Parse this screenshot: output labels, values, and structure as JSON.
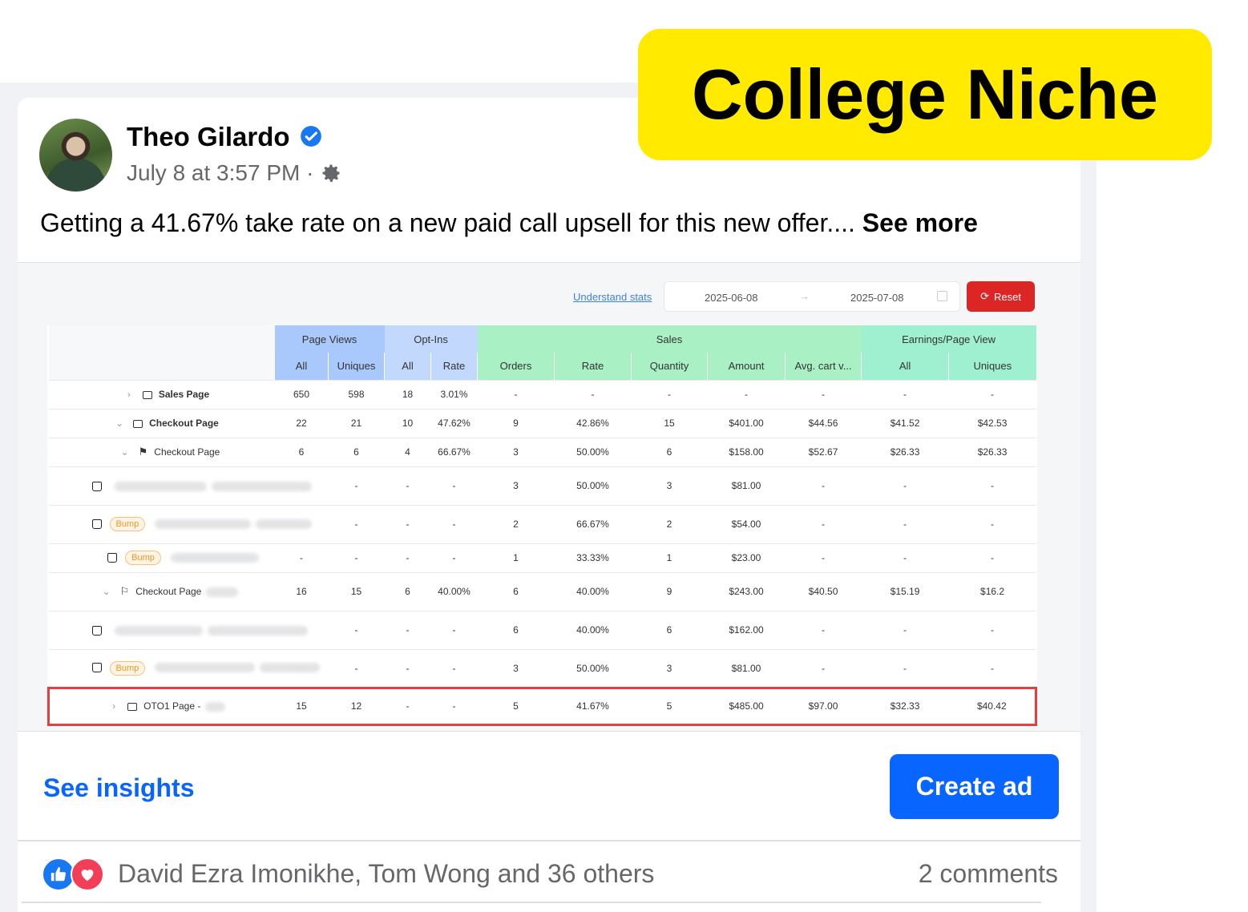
{
  "banner": {
    "text": "College Niche"
  },
  "post": {
    "author": "Theo Gilardo",
    "timestamp": "July 8 at 3:57 PM ·",
    "text": "Getting a 41.67% take rate on a new paid call upsell for this new offer....",
    "see_more": "See more"
  },
  "stats": {
    "understand_link": "Understand stats",
    "date_from": "2025-06-08",
    "date_arrow": "→",
    "date_to": "2025-07-08",
    "reset_label": "Reset",
    "groups": {
      "page_views": "Page Views",
      "opt_ins": "Opt-Ins",
      "sales": "Sales",
      "earnings": "Earnings/Page View"
    },
    "columns": {
      "all": "All",
      "uniques": "Uniques",
      "rate": "Rate",
      "orders": "Orders",
      "quantity": "Quantity",
      "amount": "Amount",
      "avg_cart": "Avg. cart v..."
    },
    "bump_label": "Bump",
    "rows": [
      {
        "name": "Sales Page",
        "v": [
          "650",
          "598",
          "18",
          "3.01%",
          "-",
          "-",
          "-",
          "-",
          "-",
          "-",
          "-"
        ]
      },
      {
        "name": "Checkout Page",
        "v": [
          "22",
          "21",
          "10",
          "47.62%",
          "9",
          "42.86%",
          "15",
          "$401.00",
          "$44.56",
          "$41.52",
          "$42.53"
        ]
      },
      {
        "name": "Checkout Page",
        "v": [
          "6",
          "6",
          "4",
          "66.67%",
          "3",
          "50.00%",
          "6",
          "$158.00",
          "$52.67",
          "$26.33",
          "$26.33"
        ]
      },
      {
        "name": "",
        "v": [
          "-",
          "-",
          "-",
          "-",
          "3",
          "50.00%",
          "3",
          "$81.00",
          "-",
          "-",
          "-"
        ]
      },
      {
        "name": "",
        "v": [
          "-",
          "-",
          "-",
          "-",
          "2",
          "66.67%",
          "2",
          "$54.00",
          "-",
          "-",
          "-"
        ]
      },
      {
        "name": "",
        "v": [
          "-",
          "-",
          "-",
          "-",
          "1",
          "33.33%",
          "1",
          "$23.00",
          "-",
          "-",
          "-"
        ]
      },
      {
        "name": "Checkout Page",
        "v": [
          "16",
          "15",
          "6",
          "40.00%",
          "6",
          "40.00%",
          "9",
          "$243.00",
          "$40.50",
          "$15.19",
          "$16.2"
        ]
      },
      {
        "name": "",
        "v": [
          "-",
          "-",
          "-",
          "-",
          "6",
          "40.00%",
          "6",
          "$162.00",
          "-",
          "-",
          "-"
        ]
      },
      {
        "name": "",
        "v": [
          "-",
          "-",
          "-",
          "-",
          "3",
          "50.00%",
          "3",
          "$81.00",
          "-",
          "-",
          "-"
        ]
      },
      {
        "name": "OTO1 Page -",
        "v": [
          "15",
          "12",
          "-",
          "-",
          "5",
          "41.67%",
          "5",
          "$485.00",
          "$97.00",
          "$32.33",
          "$40.42"
        ]
      }
    ]
  },
  "actions": {
    "see_insights": "See insights",
    "create_ad": "Create ad"
  },
  "reactions": {
    "names": "David Ezra Imonikhe, Tom Wong and 36 others",
    "comments": "2 comments"
  }
}
